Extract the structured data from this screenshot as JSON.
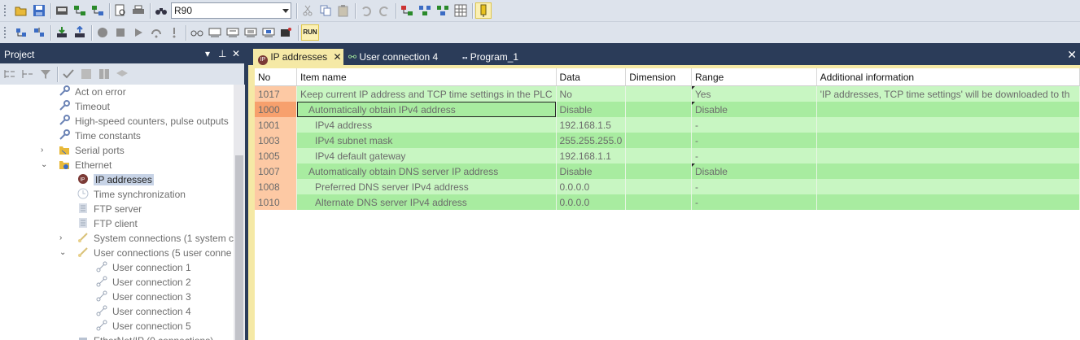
{
  "toolbar": {
    "search_combo_value": "R90",
    "run_label": "RUN"
  },
  "project_panel": {
    "title": "Project",
    "pin": "▾ ⊓ ✕"
  },
  "tree": [
    {
      "label": "Act on error",
      "indent": 1,
      "icon": "wrench-icon"
    },
    {
      "label": "Timeout",
      "indent": 1,
      "icon": "wrench-icon"
    },
    {
      "label": "High-speed counters, pulse outputs",
      "indent": 1,
      "icon": "wrench-icon"
    },
    {
      "label": "Time constants",
      "indent": 1,
      "icon": "wrench-icon"
    },
    {
      "label": "Serial ports",
      "indent": 1,
      "icon": "folder-icon",
      "expander": "›"
    },
    {
      "label": "Ethernet",
      "indent": 1,
      "icon": "folder-globe-icon",
      "expander": "⌄"
    },
    {
      "label": "IP addresses",
      "indent": 2,
      "icon": "ip-icon",
      "selected": true
    },
    {
      "label": "Time synchronization",
      "indent": 2,
      "icon": "clock-icon"
    },
    {
      "label": "FTP server",
      "indent": 2,
      "icon": "server-icon"
    },
    {
      "label": "FTP client",
      "indent": 2,
      "icon": "server-icon"
    },
    {
      "label": "System connections (1 system c",
      "indent": 2,
      "icon": "connection-icon",
      "expander": "›"
    },
    {
      "label": "User connections (5 user conne",
      "indent": 2,
      "icon": "connection-icon",
      "expander": "⌄"
    },
    {
      "label": "User connection 1",
      "indent": 3,
      "icon": "link-icon"
    },
    {
      "label": "User connection 2",
      "indent": 3,
      "icon": "link-icon"
    },
    {
      "label": "User connection 3",
      "indent": 3,
      "icon": "link-icon"
    },
    {
      "label": "User connection 4",
      "indent": 3,
      "icon": "link-icon"
    },
    {
      "label": "User connection 5",
      "indent": 3,
      "icon": "link-icon"
    },
    {
      "label": "EtherNet/IP (0 connections)",
      "indent": 2,
      "icon": "net-icon"
    }
  ],
  "tabs": [
    {
      "label": "IP addresses",
      "close": "✕",
      "active": true,
      "icon": "ip-icon"
    },
    {
      "label": "User connection 4",
      "active": false,
      "icon": "link-icon"
    },
    {
      "label": "Program_1",
      "active": false,
      "icon": "program-icon"
    }
  ],
  "doc_close": "✕",
  "grid": {
    "columns": [
      "No",
      "Item name",
      "Data",
      "Dimension",
      "Range",
      "Additional information"
    ],
    "rows": [
      {
        "no": "1017",
        "item": "Keep current IP address and TCP time settings in the PLC",
        "data": "No",
        "dim": "",
        "range": "Yes",
        "info": "'IP addresses, TCP time settings' will be downloaded to th"
      },
      {
        "no": "1000",
        "item": "Automatically obtain IPv4 address",
        "data": "Disable",
        "dim": "",
        "range": "Disable",
        "info": ""
      },
      {
        "no": "1001",
        "item": "IPv4 address",
        "data": "192.168.1.5",
        "dim": "",
        "range": "-",
        "info": ""
      },
      {
        "no": "1003",
        "item": "IPv4 subnet mask",
        "data": "255.255.255.0",
        "dim": "",
        "range": "-",
        "info": ""
      },
      {
        "no": "1005",
        "item": "IPv4 default gateway",
        "data": "192.168.1.1",
        "dim": "",
        "range": "-",
        "info": ""
      },
      {
        "no": "1007",
        "item": "Automatically obtain DNS server IP address",
        "data": "Disable",
        "dim": "",
        "range": "Disable",
        "info": ""
      },
      {
        "no": "1008",
        "item": "Preferred DNS server IPv4 address",
        "data": "0.0.0.0",
        "dim": "",
        "range": "-",
        "info": ""
      },
      {
        "no": "1010",
        "item": "Alternate DNS server IPv4 address",
        "data": "0.0.0.0",
        "dim": "",
        "range": "-",
        "info": ""
      }
    ]
  }
}
